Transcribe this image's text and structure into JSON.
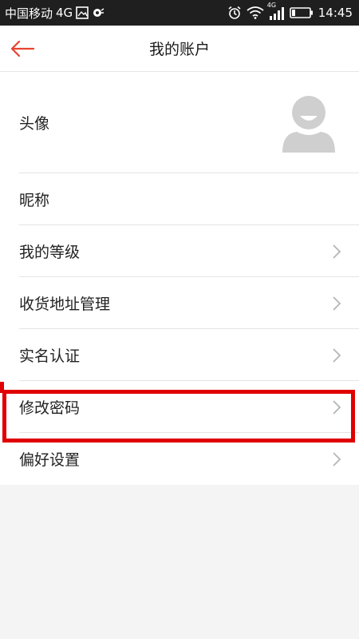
{
  "status_bar": {
    "carrier": "中国移动",
    "network": "4G",
    "signal_label": "4G",
    "time": "14:45"
  },
  "nav": {
    "title": "我的账户",
    "back_icon": "arrow-left-icon"
  },
  "rows": [
    {
      "label": "头像",
      "type": "avatar"
    },
    {
      "label": "昵称",
      "type": "plain"
    },
    {
      "label": "我的等级",
      "type": "chevron"
    },
    {
      "label": "收货地址管理",
      "type": "chevron"
    },
    {
      "label": "实名认证",
      "type": "chevron"
    },
    {
      "label": "修改密码",
      "type": "chevron",
      "highlighted": true
    },
    {
      "label": "偏好设置",
      "type": "chevron"
    }
  ],
  "colors": {
    "accent": "#e8432f",
    "highlight": "#e00000",
    "background": "#f4f4f4"
  }
}
